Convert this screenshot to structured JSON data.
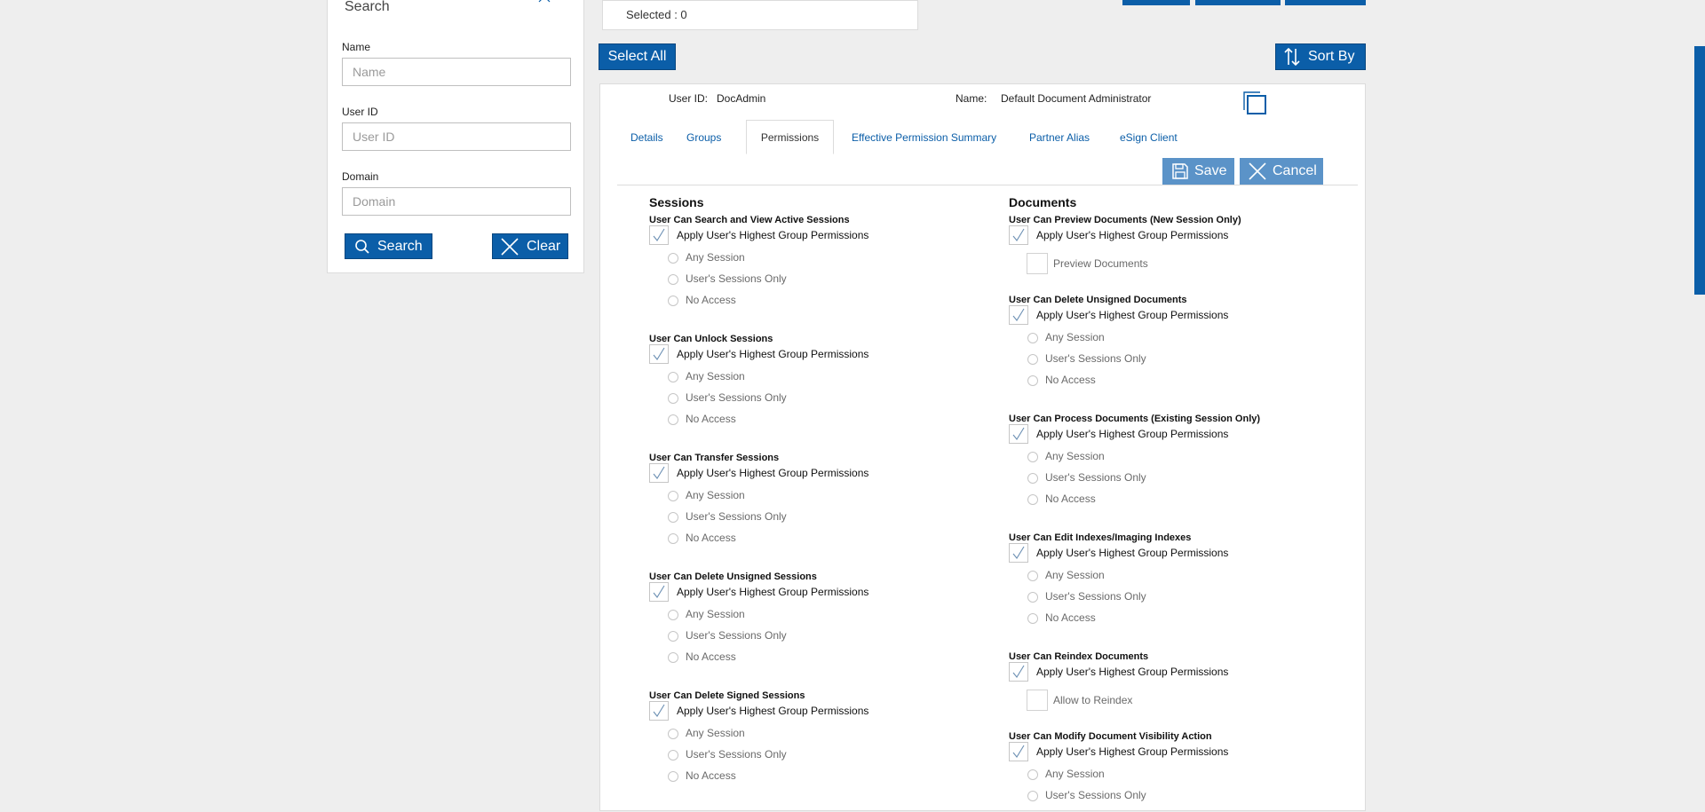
{
  "search_panel": {
    "title": "Search",
    "fields": [
      {
        "label": "Name",
        "placeholder": "Name"
      },
      {
        "label": "User ID",
        "placeholder": "User ID"
      },
      {
        "label": "Domain",
        "placeholder": "Domain"
      }
    ],
    "search_label": "Search",
    "clear_label": "Clear"
  },
  "selection": {
    "text": "Selected : 0"
  },
  "toolbar": {
    "select_all_label": "Select All",
    "sort_by_label": "Sort By"
  },
  "user": {
    "user_id_label": "User ID:",
    "user_id": "DocAdmin",
    "name_label": "Name:",
    "name": "Default Document Administrator"
  },
  "tabs": [
    {
      "label": "Details",
      "active": false
    },
    {
      "label": "Groups",
      "active": false
    },
    {
      "label": "Permissions",
      "active": true
    },
    {
      "label": "Effective Permission Summary",
      "active": false
    },
    {
      "label": "Partner Alias",
      "active": false
    },
    {
      "label": "eSign Client",
      "active": false
    }
  ],
  "actions": {
    "save_label": "Save",
    "cancel_label": "Cancel"
  },
  "colors": {
    "brand": "#0b5ea8",
    "action_light": "#5b93c8"
  },
  "sessions": {
    "title": "Sessions",
    "groups": [
      {
        "title": "User Can Search and View Active Sessions",
        "apply_label": "Apply User's Highest Group Permissions",
        "apply_checked": true,
        "options": [
          "Any Session",
          "User's Sessions Only",
          "No Access"
        ]
      },
      {
        "title": "User Can Unlock Sessions",
        "apply_label": "Apply User's Highest Group Permissions",
        "apply_checked": true,
        "options": [
          "Any Session",
          "User's Sessions Only",
          "No Access"
        ]
      },
      {
        "title": "User Can Transfer Sessions",
        "apply_label": "Apply User's Highest Group Permissions",
        "apply_checked": true,
        "options": [
          "Any Session",
          "User's Sessions Only",
          "No Access"
        ]
      },
      {
        "title": "User Can Delete Unsigned Sessions",
        "apply_label": "Apply User's Highest Group Permissions",
        "apply_checked": true,
        "options": [
          "Any Session",
          "User's Sessions Only",
          "No Access"
        ]
      },
      {
        "title": "User Can Delete Signed Sessions",
        "apply_label": "Apply User's Highest Group Permissions",
        "apply_checked": true,
        "options": [
          "Any Session",
          "User's Sessions Only",
          "No Access"
        ]
      }
    ]
  },
  "documents": {
    "title": "Documents",
    "groups": [
      {
        "title": "User Can Preview Documents (New Session Only)",
        "apply_label": "Apply User's Highest Group Permissions",
        "apply_checked": true,
        "sub_checkbox": "Preview Documents"
      },
      {
        "title": "User Can Delete Unsigned Documents",
        "apply_label": "Apply User's Highest Group Permissions",
        "apply_checked": true,
        "options": [
          "Any Session",
          "User's Sessions Only",
          "No Access"
        ]
      },
      {
        "title": "User Can Process Documents (Existing Session Only)",
        "apply_label": "Apply User's Highest Group Permissions",
        "apply_checked": true,
        "options": [
          "Any Session",
          "User's Sessions Only",
          "No Access"
        ]
      },
      {
        "title": "User Can Edit Indexes/Imaging Indexes",
        "apply_label": "Apply User's Highest Group Permissions",
        "apply_checked": true,
        "options": [
          "Any Session",
          "User's Sessions Only",
          "No Access"
        ]
      },
      {
        "title": "User Can Reindex Documents",
        "apply_label": "Apply User's Highest Group Permissions",
        "apply_checked": true,
        "sub_checkbox": "Allow to Reindex"
      },
      {
        "title": "User Can Modify Document Visibility Action",
        "apply_label": "Apply User's Highest Group Permissions",
        "apply_checked": true,
        "options": [
          "Any Session",
          "User's Sessions Only"
        ]
      }
    ]
  }
}
